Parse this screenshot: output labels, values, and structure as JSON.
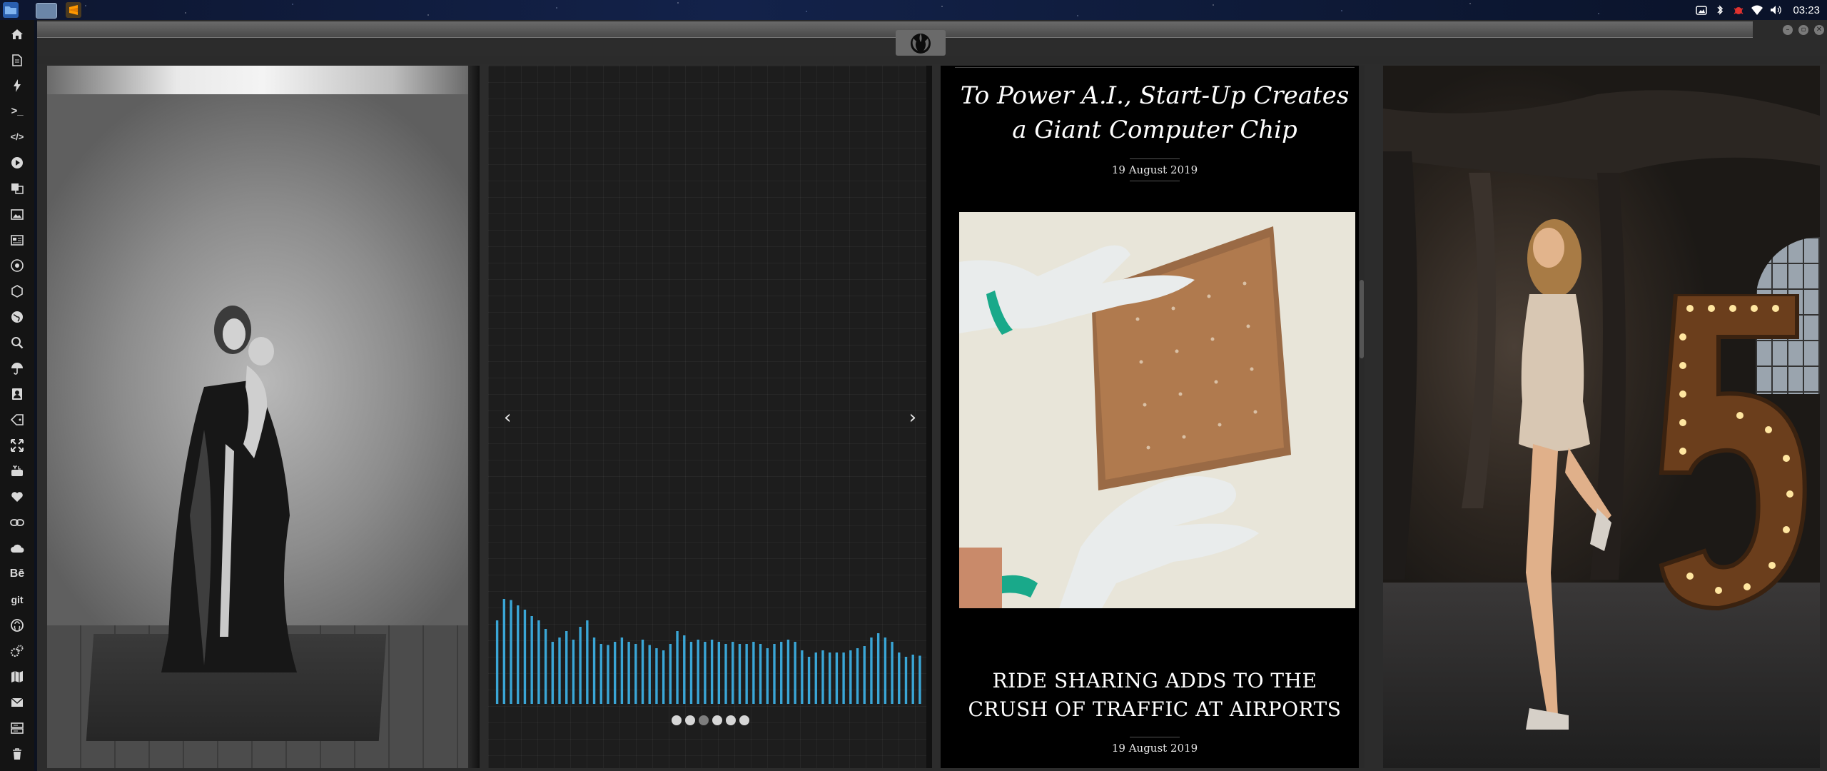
{
  "system_bar": {
    "clock": "03:23",
    "apps": [
      "file-manager",
      "window-thumbnail",
      "sublime-text"
    ],
    "tray_icons": [
      "screenshot-icon",
      "bluetooth-icon",
      "bug-icon",
      "wifi-icon",
      "volume-icon"
    ]
  },
  "dock": {
    "items": [
      {
        "icon": "home-icon"
      },
      {
        "icon": "document-icon"
      },
      {
        "icon": "lightning-icon"
      },
      {
        "icon": "terminal-icon",
        "text": ">_"
      },
      {
        "icon": "code-icon",
        "text": "</>"
      },
      {
        "icon": "play-icon"
      },
      {
        "icon": "translate-icon"
      },
      {
        "icon": "image-icon"
      },
      {
        "icon": "newspaper-icon"
      },
      {
        "icon": "react-icon"
      },
      {
        "icon": "hexagon-icon"
      },
      {
        "icon": "globe-icon"
      },
      {
        "icon": "search-icon"
      },
      {
        "icon": "umbrella-icon"
      },
      {
        "icon": "contact-icon"
      },
      {
        "icon": "tag-icon"
      },
      {
        "icon": "expand-icon"
      },
      {
        "icon": "youtube-icon"
      },
      {
        "icon": "heart-icon"
      },
      {
        "icon": "link-icon"
      },
      {
        "icon": "cloud-icon"
      },
      {
        "icon": "behance-icon",
        "text": "Bē"
      },
      {
        "icon": "git-icon",
        "text": "git"
      },
      {
        "icon": "github-icon"
      },
      {
        "icon": "cogs-icon"
      },
      {
        "icon": "map-icon"
      },
      {
        "icon": "mail-icon"
      },
      {
        "icon": "server-icon"
      },
      {
        "icon": "trash-icon"
      }
    ]
  },
  "window": {
    "controls": [
      "minimize",
      "maximize",
      "close"
    ],
    "logo": "rebel-alliance-icon"
  },
  "visualizer": {
    "prev_label": "‹",
    "next_label": "›",
    "bar_levels": [
      0.78,
      0.98,
      0.97,
      0.92,
      0.88,
      0.82,
      0.78,
      0.7,
      0.58,
      0.62,
      0.68,
      0.6,
      0.72,
      0.78,
      0.62,
      0.56,
      0.55,
      0.58,
      0.62,
      0.58,
      0.56,
      0.6,
      0.55,
      0.52,
      0.5,
      0.56,
      0.68,
      0.64,
      0.58,
      0.6,
      0.58,
      0.6,
      0.58,
      0.56,
      0.58,
      0.56,
      0.56,
      0.58,
      0.56,
      0.52,
      0.56,
      0.58,
      0.6,
      0.58,
      0.5,
      0.44,
      0.48,
      0.5,
      0.48,
      0.48,
      0.48,
      0.5,
      0.52,
      0.54,
      0.62,
      0.66,
      0.62,
      0.58,
      0.48,
      0.44,
      0.46,
      0.45
    ],
    "bar_color": "#3aa6d6",
    "dots": 6,
    "active_dot": 2
  },
  "articles": [
    {
      "title": "To Power A.I., Start-Up Creates a Giant Computer Chip",
      "date": "19 August 2019"
    },
    {
      "title": "RIDE SHARING ADDS TO THE CRUSH OF TRAFFIC AT AIRPORTS",
      "date": "19 August 2019"
    }
  ]
}
